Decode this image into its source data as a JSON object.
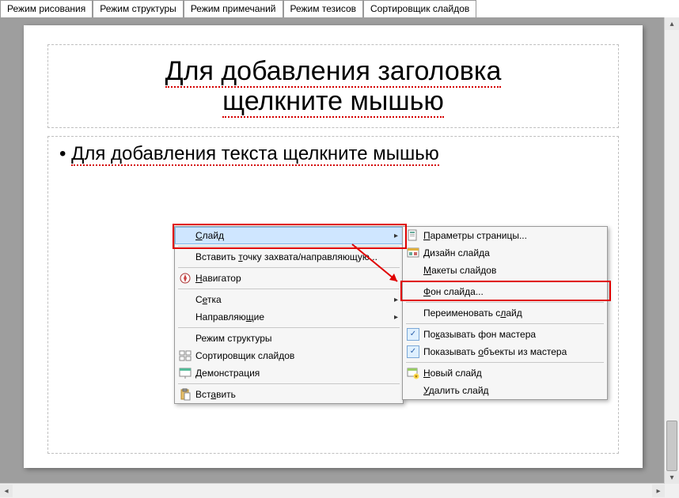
{
  "tabs": {
    "drawing": "Режим рисования",
    "outline": "Режим структуры",
    "notes": "Режим примечаний",
    "handout": "Режим тезисов",
    "sorter": "Сортировщик слайдов"
  },
  "slide": {
    "title_line1": "Для добавления заголовка",
    "title_line2": "щелкните мышью",
    "bullet1": "Для добавления текста щелкните мышью"
  },
  "context_menu": {
    "slide": "Слайд",
    "insert_snap": "Вставить точку захвата/направляющую...",
    "navigator": "Навигатор",
    "grid": "Сетка",
    "guides": "Направляющие",
    "outline_mode": "Режим структуры",
    "slide_sorter": "Сортировщик слайдов",
    "presentation": "Демонстрация",
    "paste": "Вставить"
  },
  "submenu": {
    "page_setup": "Параметры страницы...",
    "slide_design": "Дизайн слайда",
    "layouts": "Макеты слайдов",
    "background": "Фон слайда...",
    "rename": "Переименовать слайд",
    "show_master_bg": "Показывать фон мастера",
    "show_master_objs": "Показывать объекты из мастера",
    "new_slide": "Новый слайд",
    "delete_slide": "Удалить слайд"
  }
}
